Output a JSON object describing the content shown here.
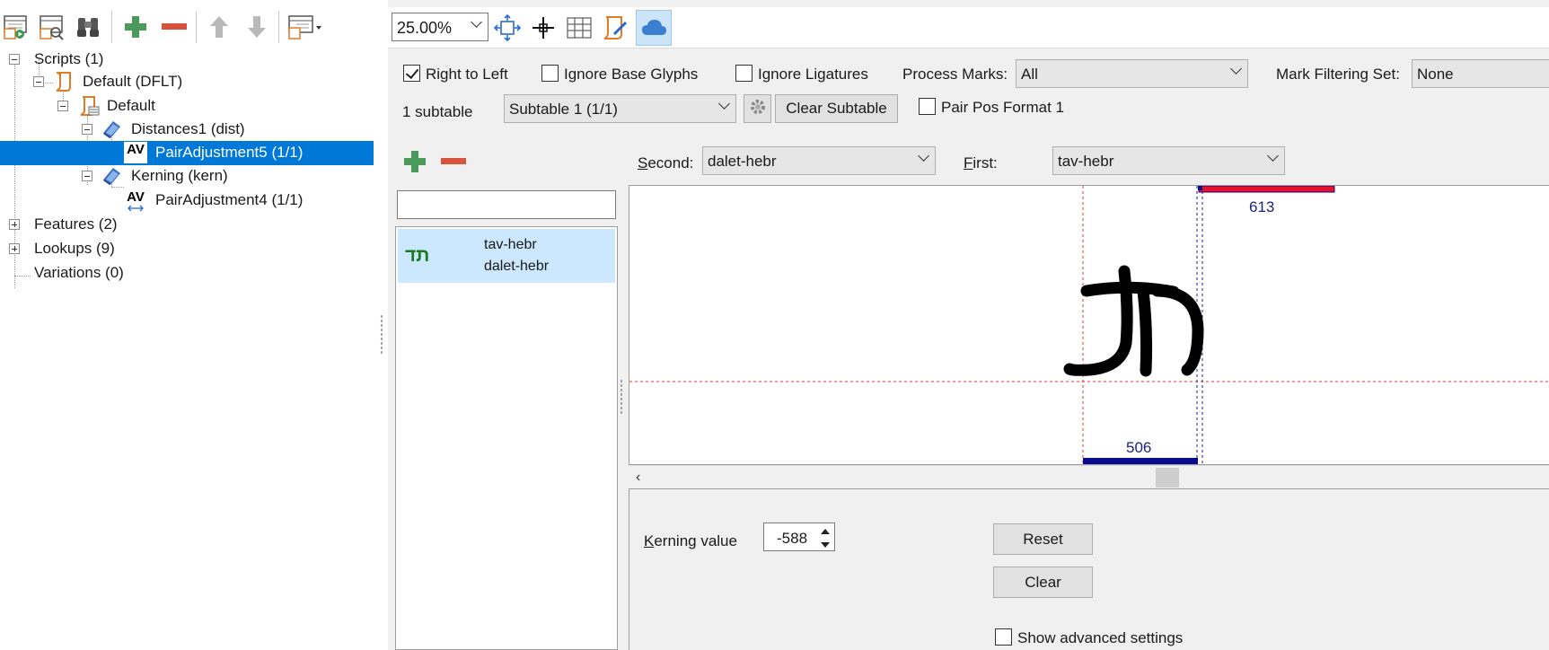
{
  "left_toolbar": {
    "icons": [
      "run-script-icon",
      "find-lookup-icon",
      "binoculars-icon",
      "add-icon",
      "remove-icon",
      "move-up-icon",
      "move-down-icon",
      "options-dropdown-icon"
    ]
  },
  "tree": {
    "scripts": "Scripts (1)",
    "default_dflt": "Default (DFLT)",
    "default": "Default",
    "distances": "Distances1 (dist)",
    "pair5": "PairAdjustment5 (1/1)",
    "kerning": "Kerning (kern)",
    "pair4": "PairAdjustment4 (1/1)",
    "features": "Features (2)",
    "lookups": "Lookups (9)",
    "variations": "Variations (0)",
    "av_glyph": "AV"
  },
  "toolbar": {
    "zoom": "25.00%"
  },
  "options": {
    "right_to_left": "Right to Left",
    "right_to_left_checked": true,
    "ignore_base": "Ignore Base Glyphs",
    "ignore_ligatures": "Ignore Ligatures",
    "process_marks_label": "Process Marks:",
    "process_marks_value": "All",
    "mark_filtering_label": "Mark Filtering Set:",
    "mark_filtering_value": "None",
    "subtable_count": "1 subtable",
    "subtable_value": "Subtable 1 (1/1)",
    "clear_subtable": "Clear Subtable",
    "pair_pos_format": "Pair Pos Format 1"
  },
  "pair_editor": {
    "second_label_u": "S",
    "second_label_rest": "econd:",
    "second_value": "dalet-hebr",
    "first_label_u": "F",
    "first_label_rest": "irst:",
    "first_value": "tav-hebr",
    "list_item_glyph": "תד",
    "list_item_first": "tav-hebr",
    "list_item_second": "dalet-hebr"
  },
  "preview": {
    "top_width": "613",
    "bottom_width": "506",
    "glyph_text": "תד"
  },
  "bottom": {
    "kerning_label_u": "K",
    "kerning_label_rest": "erning value",
    "kerning_value": "-588",
    "reset": "Reset",
    "clear": "Clear",
    "show_advanced": "Show advanced settings"
  },
  "colors": {
    "accent": "#0078d7",
    "add_green": "#4a9a5c",
    "remove_red": "#d9533c",
    "bar_red": "#e8102a",
    "bar_blue": "#0a0a8c",
    "guide_red": "#e53935",
    "guide_blue": "#1a237e"
  }
}
